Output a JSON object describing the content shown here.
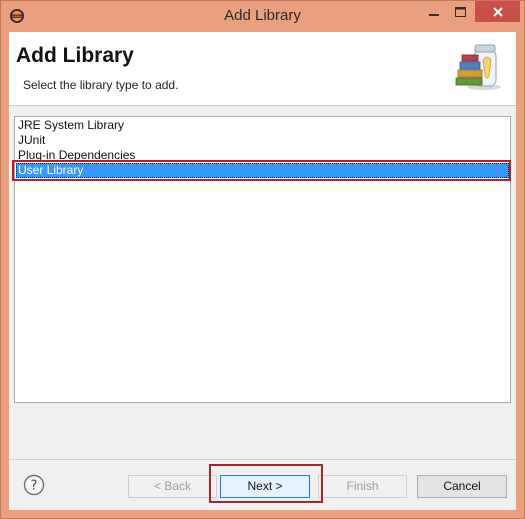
{
  "window": {
    "title": "Add Library",
    "titlebar_color": "#e9a07f",
    "close_color": "#c7504b"
  },
  "header": {
    "title": "Add Library",
    "description": "Select the library type to add.",
    "image_icon": "library-jar-icon"
  },
  "library_types": [
    {
      "label": "JRE System Library",
      "selected": false
    },
    {
      "label": "JUnit",
      "selected": false
    },
    {
      "label": "Plug-in Dependencies",
      "selected": false
    },
    {
      "label": "User Library",
      "selected": true
    }
  ],
  "buttons": {
    "back": "< Back",
    "next": "Next >",
    "finish": "Finish",
    "cancel": "Cancel",
    "help_icon": "help-icon"
  },
  "annotations": {
    "highlight_color": "#a7232e",
    "selection_color": "#3399ff"
  }
}
